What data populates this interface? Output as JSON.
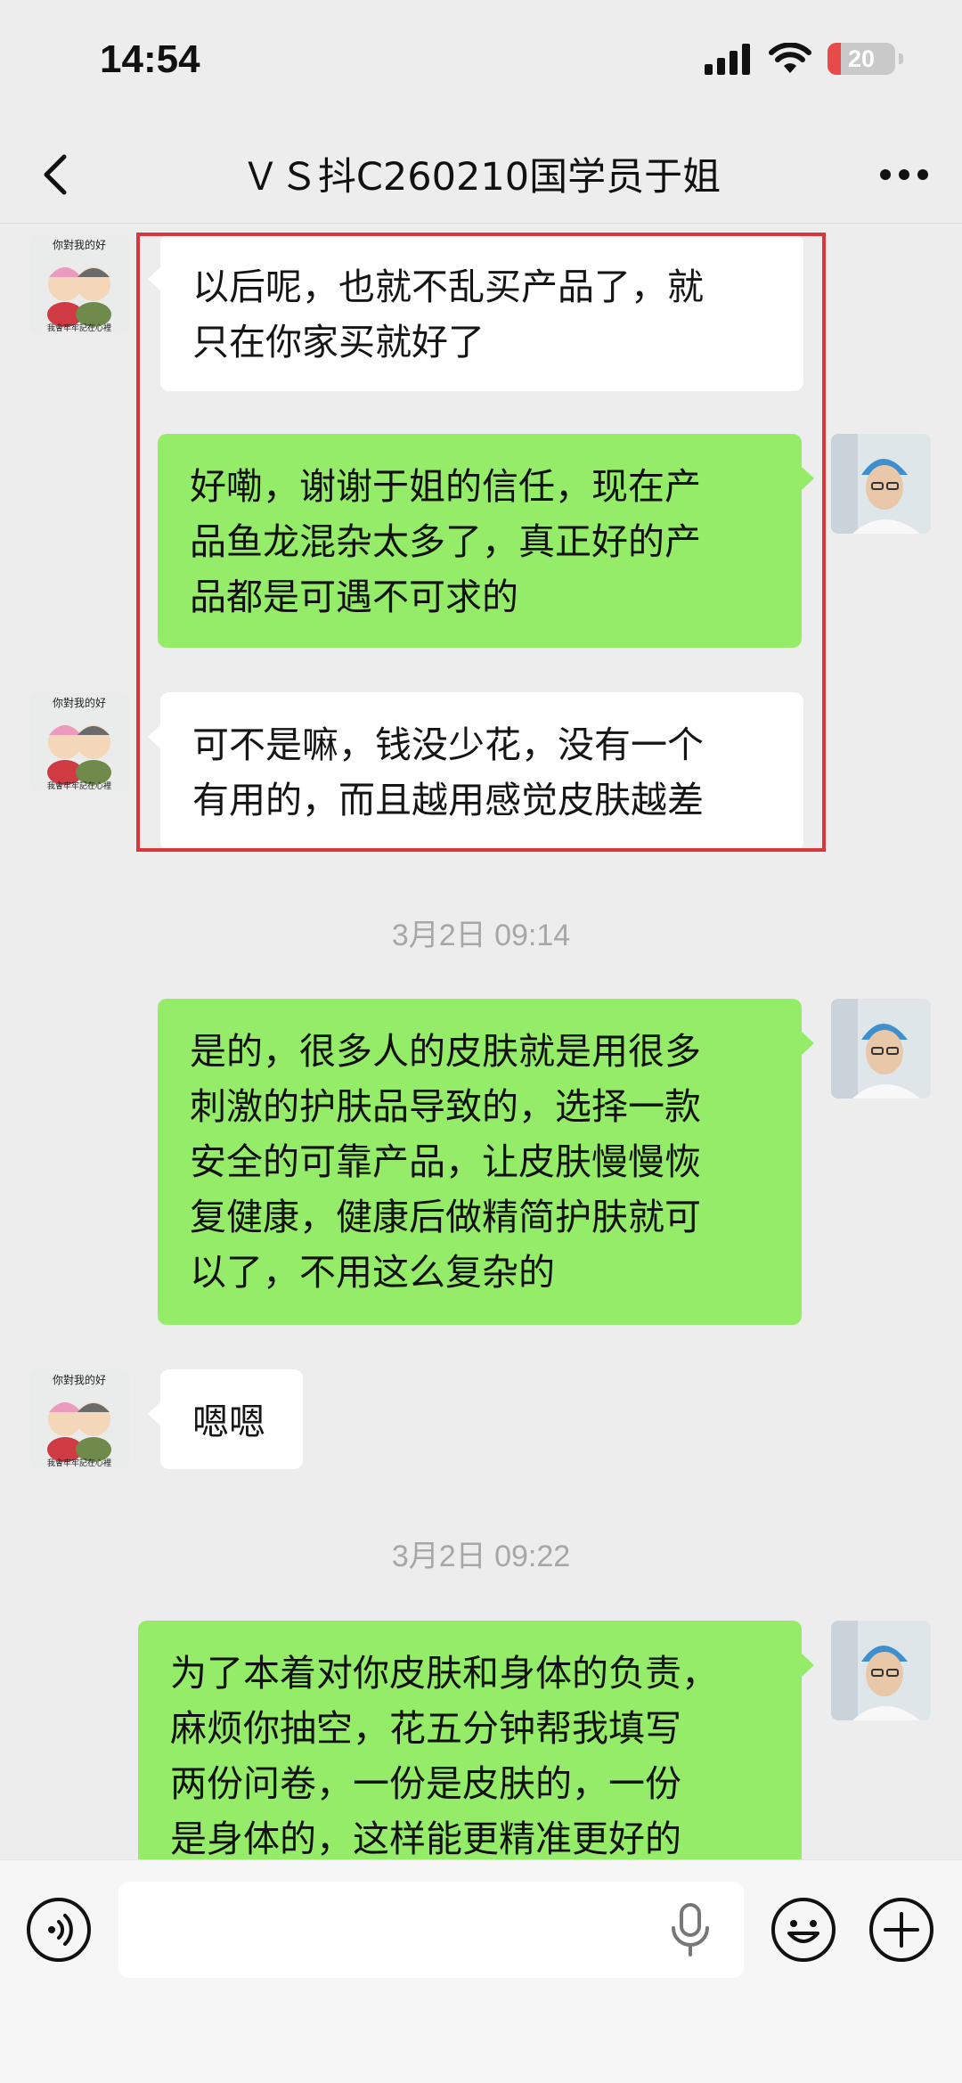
{
  "status_bar": {
    "time": "14:54",
    "battery_level": "20",
    "battery_fraction": 0.2,
    "icons": [
      "signal-icon",
      "wifi-icon",
      "battery-icon"
    ]
  },
  "nav": {
    "title": "ＶＳ抖C260210国学员于姐",
    "back_icon": "chevron-left-icon",
    "more_icon": "more-dots-icon"
  },
  "chat": {
    "highlight_color": "#d9373c",
    "incoming_bubble_color": "#ffffff",
    "outgoing_bubble_color": "#95ec69",
    "contact_avatar_text": {
      "top": "你對我的好",
      "bottom": "我會牢牢記在心裡"
    },
    "messages": [
      {
        "side": "in",
        "lines": [
          "以后呢，也就不乱买产品了，就",
          "只在你家买就好了"
        ]
      },
      {
        "side": "out",
        "lines": [
          "好嘞，谢谢于姐的信任，现在产",
          "品鱼龙混杂太多了，真正好的产",
          "品都是可遇不可求的"
        ]
      },
      {
        "side": "in",
        "lines": [
          "可不是嘛，钱没少花，没有一个",
          "有用的，而且越用感觉皮肤越差"
        ]
      },
      {
        "type": "time",
        "text": "3月2日 09:14"
      },
      {
        "side": "out",
        "lines": [
          "是的，很多人的皮肤就是用很多",
          "刺激的护肤品导致的，选择一款",
          "安全的可靠产品，让皮肤慢慢恢",
          "复健康，健康后做精简护肤就可",
          "以了，不用这么复杂的"
        ]
      },
      {
        "side": "in",
        "lines": [
          "嗯嗯"
        ]
      },
      {
        "type": "time",
        "text": "3月2日 09:22"
      },
      {
        "side": "out",
        "lines": [
          "为了本着对你皮肤和身体的负责，",
          "麻烦你抽空，花五分钟帮我填写",
          "两份问卷，一份是皮肤的，一份",
          "是身体的，这样能更精准更好的"
        ]
      }
    ]
  },
  "input_bar": {
    "value": "",
    "icons": [
      "voice-mode-icon",
      "microphone-icon",
      "emoji-icon",
      "plus-icon"
    ]
  }
}
